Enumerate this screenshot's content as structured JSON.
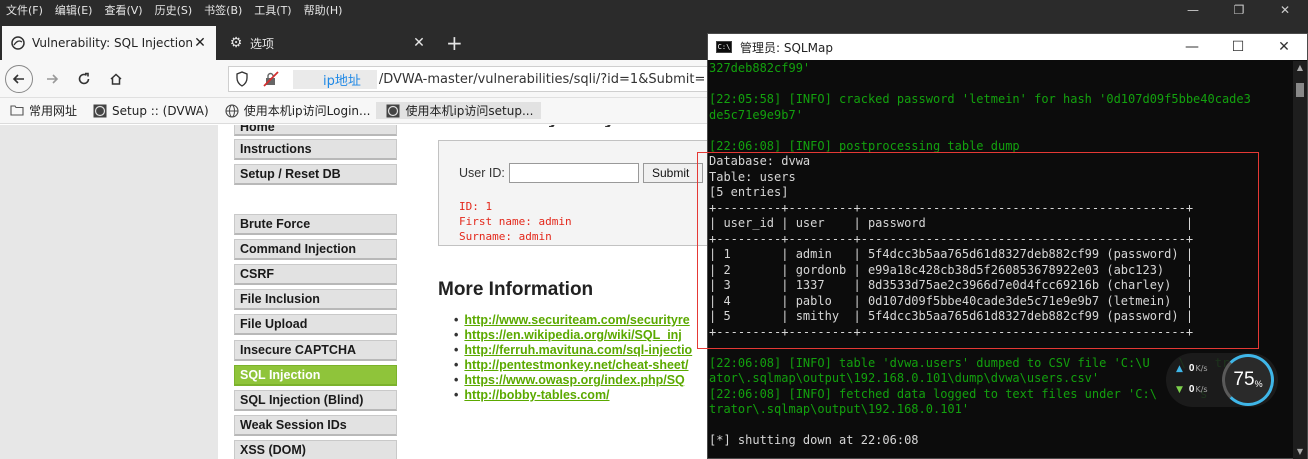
{
  "browser": {
    "menu": [
      "文件(F)",
      "编辑(E)",
      "查看(V)",
      "历史(S)",
      "书签(B)",
      "工具(T)",
      "帮助(H)"
    ],
    "tabs": [
      {
        "title": "Vulnerability: SQL Injection ::",
        "active": true
      },
      {
        "title": "选项",
        "active": false
      }
    ],
    "new_tab": "+",
    "url_host": "ip地址",
    "url_path": "/DVWA-master/vulnerabilities/sqli/?id=1&Submit=",
    "bookmarks": [
      "常用网址",
      "Setup :: (DVWA)",
      "使用本机ip访问Login...",
      "使用本机ip访问setup..."
    ]
  },
  "dvwa": {
    "menu_top": [
      "Instructions",
      "Setup / Reset DB"
    ],
    "menu_vulns": [
      {
        "label": "Brute Force",
        "selected": false
      },
      {
        "label": "Command Injection",
        "selected": false
      },
      {
        "label": "CSRF",
        "selected": false
      },
      {
        "label": "File Inclusion",
        "selected": false
      },
      {
        "label": "File Upload",
        "selected": false
      },
      {
        "label": "Insecure CAPTCHA",
        "selected": false
      },
      {
        "label": "SQL Injection",
        "selected": true
      },
      {
        "label": "SQL Injection (Blind)",
        "selected": false
      },
      {
        "label": "Weak Session IDs",
        "selected": false
      },
      {
        "label": "XSS (DOM)",
        "selected": false
      }
    ],
    "form": {
      "user_id_label": "User ID:",
      "user_id_value": "",
      "submit_label": "Submit"
    },
    "result": [
      "ID: 1",
      "First name: admin",
      "Surname: admin"
    ],
    "more_info_title": "More Information",
    "links": [
      "http://www.securiteam.com/securityre",
      "https://en.wikipedia.org/wiki/SQL_inj",
      "http://ferruh.mavituna.com/sql-injectio",
      "http://pentestmonkey.net/cheat-sheet/",
      "https://www.owasp.org/index.php/SQ",
      "http://bobby-tables.com/"
    ]
  },
  "console": {
    "title": "管理员: SQLMap",
    "icon_label": "C:\\",
    "lines": [
      {
        "text": "327deb882cf99'",
        "color": "green"
      },
      {
        "text": "",
        "color": "green"
      },
      {
        "text": "[22:05:58] [INFO] cracked password 'letmein' for hash '0d107d09f5bbe40cade3",
        "color": "green"
      },
      {
        "text": "de5c71e9e9b7'",
        "color": "green"
      },
      {
        "text": "",
        "color": "green"
      },
      {
        "text": "[22:06:08] [INFO] postprocessing table dump",
        "color": "green"
      },
      {
        "text": "Database: dvwa",
        "color": "white"
      },
      {
        "text": "Table: users",
        "color": "white"
      },
      {
        "text": "[5 entries]",
        "color": "white"
      },
      {
        "text": "+---------+---------+---------------------------------------------+",
        "color": "white"
      },
      {
        "text": "| user_id | user    | password                                    |",
        "color": "white"
      },
      {
        "text": "+---------+---------+---------------------------------------------+",
        "color": "white"
      },
      {
        "text": "| 1       | admin   | 5f4dcc3b5aa765d61d8327deb882cf99 (password) |",
        "color": "white"
      },
      {
        "text": "| 2       | gordonb | e99a18c428cb38d5f260853678922e03 (abc123)   |",
        "color": "white"
      },
      {
        "text": "| 3       | 1337    | 8d3533d75ae2c3966d7e0d4fcc69216b (charley)  |",
        "color": "white"
      },
      {
        "text": "| 4       | pablo   | 0d107d09f5bbe40cade3de5c71e9e9b7 (letmein)  |",
        "color": "white"
      },
      {
        "text": "| 5       | smithy  | 5f4dcc3b5aa765d61d8327deb882cf99 (password) |",
        "color": "white"
      },
      {
        "text": "+---------+---------+---------------------------------------------+",
        "color": "white"
      },
      {
        "text": "",
        "color": "white"
      },
      {
        "text": "[22:06:08] [INFO] table 'dvwa.users' dumped to CSV file 'C:\\U    \\    tr",
        "color": "green"
      },
      {
        "text": "ator\\.sqlmap\\output\\192.168.0.101\\dump\\dvwa\\users.csv'",
        "color": "green"
      },
      {
        "text": "[22:06:08] [INFO] fetched data logged to text files under 'C:\\      s",
        "color": "green"
      },
      {
        "text": "trator\\.sqlmap\\output\\192.168.0.101'",
        "color": "green"
      },
      {
        "text": "",
        "color": "white"
      },
      {
        "text": "[*] shutting down at 22:06:08",
        "color": "white"
      }
    ]
  },
  "net_widget": {
    "upload": "0",
    "download": "0",
    "unit": "K/s",
    "percent": "75",
    "percent_sign": "%"
  }
}
